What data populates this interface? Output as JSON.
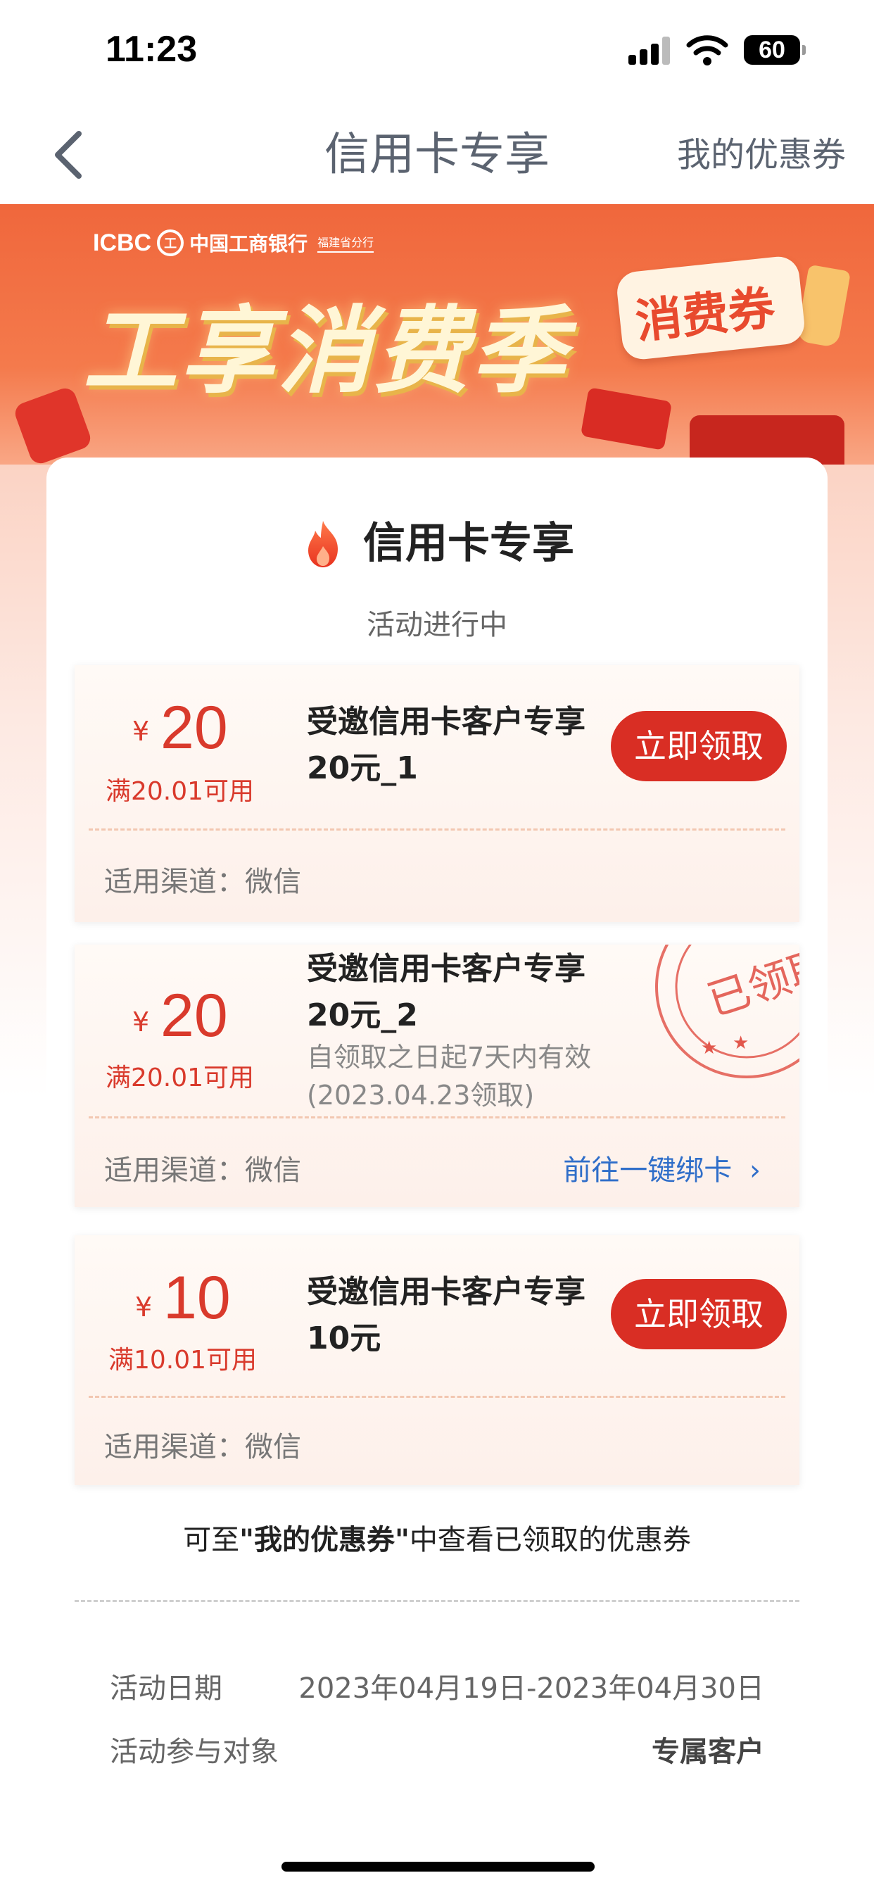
{
  "status_bar": {
    "time": "11:23",
    "battery": "60"
  },
  "nav": {
    "title": "信用卡专享",
    "right_link": "我的优惠券"
  },
  "banner": {
    "bank_en": "ICBC",
    "bank_seal": "工",
    "bank_cn": "中国工商银行",
    "branch": "福建省分行",
    "title": "工享消费季",
    "badge": "消费券"
  },
  "section": {
    "title": "信用卡专享",
    "status": "活动进行中"
  },
  "coupons": [
    {
      "currency": "¥",
      "amount": "20",
      "threshold": "满20.01可用",
      "name": "受邀信用卡客户专享20元_1",
      "button": "立即领取",
      "channel": "适用渠道：微信"
    },
    {
      "currency": "¥",
      "amount": "20",
      "threshold": "满20.01可用",
      "name": "受邀信用卡客户专享20元_2",
      "validity": "自领取之日起7天内有效",
      "claim_date": "(2023.04.23领取)",
      "stamp": "已领取",
      "channel": "适用渠道：微信",
      "link": "前往一键绑卡"
    },
    {
      "currency": "¥",
      "amount": "10",
      "threshold": "满10.01可用",
      "name": "受邀信用卡客户专享10元",
      "button": "立即领取",
      "channel": "适用渠道：微信"
    }
  ],
  "hint": {
    "prefix": "可至",
    "highlight": "\"我的优惠券\"",
    "suffix": "中查看已领取的优惠券"
  },
  "info": {
    "date_label": "活动日期",
    "date_value": "2023年04月19日-2023年04月30日",
    "target_label": "活动参与对象",
    "target_value": "专属客户"
  },
  "colors": {
    "accent": "#d92e24",
    "link": "#2f6ec9",
    "banner": "#f0673c"
  }
}
